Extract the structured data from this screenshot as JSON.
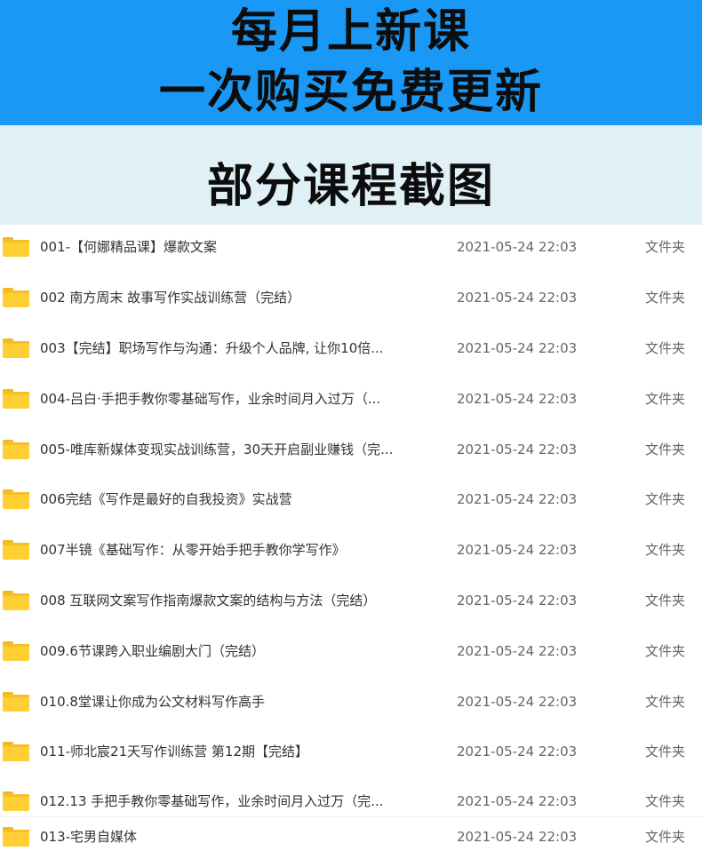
{
  "banner": {
    "line1": "每月上新课",
    "line2": "一次购买免费更新"
  },
  "subtitle": "部分课程截图",
  "colors": {
    "banner_bg": "#1a98f5",
    "subbanner_bg": "#dff0f7",
    "folder": "#ffcf33"
  },
  "folder_icon": "folder-icon",
  "files": [
    {
      "name": "001-【何娜精品课】爆款文案",
      "date": "2021-05-24 22:03",
      "type": "文件夹"
    },
    {
      "name": "002 南方周末 故事写作实战训练营（完结）",
      "date": "2021-05-24 22:03",
      "type": "文件夹"
    },
    {
      "name": "003【完结】职场写作与沟通：升级个人品牌, 让你10倍...",
      "date": "2021-05-24 22:03",
      "type": "文件夹"
    },
    {
      "name": "004-吕白·手把手教你零基础写作，业余时间月入过万（...",
      "date": "2021-05-24 22:03",
      "type": "文件夹"
    },
    {
      "name": "005-唯库新媒体变现实战训练营，30天开启副业赚钱（完...",
      "date": "2021-05-24 22:03",
      "type": "文件夹"
    },
    {
      "name": "006完结《写作是最好的自我投资》实战营",
      "date": "2021-05-24 22:03",
      "type": "文件夹"
    },
    {
      "name": "007半镜《基础写作：从零开始手把手教你学写作》",
      "date": "2021-05-24 22:03",
      "type": "文件夹"
    },
    {
      "name": "008 互联网文案写作指南爆款文案的结构与方法（完结）",
      "date": "2021-05-24 22:03",
      "type": "文件夹"
    },
    {
      "name": "009.6节课跨入职业编剧大门（完结）",
      "date": "2021-05-24 22:03",
      "type": "文件夹"
    },
    {
      "name": "010.8堂课让你成为公文材料写作高手",
      "date": "2021-05-24 22:03",
      "type": "文件夹"
    },
    {
      "name": "011-师北宸21天写作训练营 第12期【完结】",
      "date": "2021-05-24 22:03",
      "type": "文件夹"
    },
    {
      "name": "012.13 手把手教你零基础写作，业余时间月入过万（完...",
      "date": "2021-05-24 22:03",
      "type": "文件夹"
    },
    {
      "name": "013-宅男自媒体",
      "date": "2021-05-24 22:03",
      "type": "文件夹"
    }
  ]
}
